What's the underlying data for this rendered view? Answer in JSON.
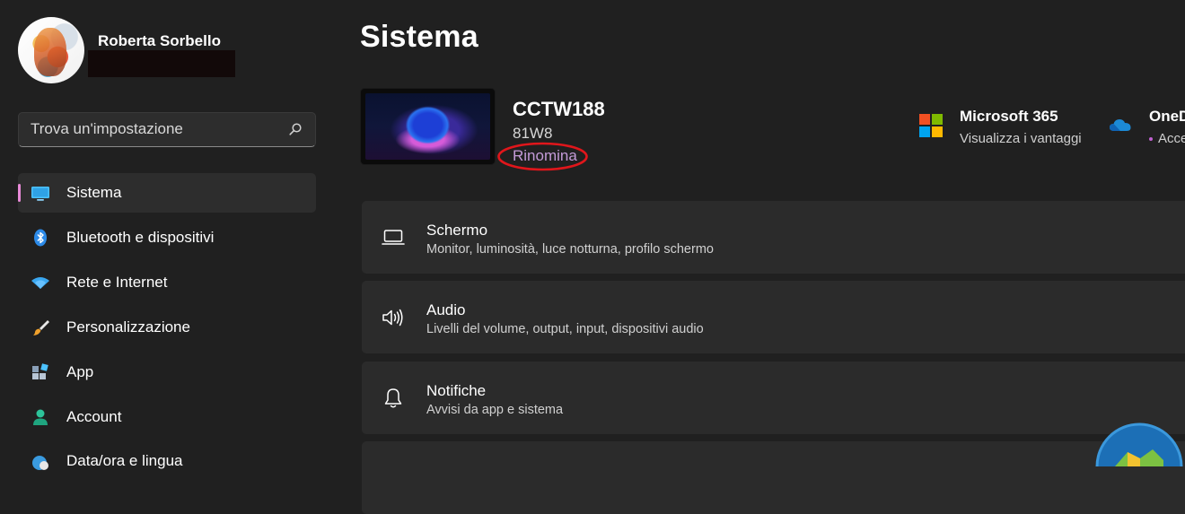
{
  "user": {
    "name": "Roberta Sorbello"
  },
  "search": {
    "placeholder": "Trova un'impostazione",
    "icon": "search-icon"
  },
  "sidebar": {
    "items": [
      {
        "label": "Sistema",
        "icon": "monitor-icon",
        "active": true
      },
      {
        "label": "Bluetooth e dispositivi",
        "icon": "bluetooth-icon"
      },
      {
        "label": "Rete e Internet",
        "icon": "wifi-icon"
      },
      {
        "label": "Personalizzazione",
        "icon": "brush-icon"
      },
      {
        "label": "App",
        "icon": "apps-icon"
      },
      {
        "label": "Account",
        "icon": "account-icon"
      },
      {
        "label": "Data/ora e lingua",
        "icon": "globe-clock-icon"
      }
    ]
  },
  "main": {
    "title": "Sistema",
    "device": {
      "name": "CCTW188",
      "model": "81W8",
      "rename_label": "Rinomina"
    },
    "promos": [
      {
        "title": "Microsoft 365",
        "subtitle": "Visualizza i vantaggi",
        "icon": "microsoft-logo-icon"
      },
      {
        "title": "OneD",
        "subtitle": "Acce",
        "icon": "onedrive-cloud-icon"
      }
    ],
    "cards": [
      {
        "title": "Schermo",
        "description": "Monitor, luminosità, luce notturna, profilo schermo",
        "icon": "laptop-icon"
      },
      {
        "title": "Audio",
        "description": "Livelli del volume, output, input, dispositivi audio",
        "icon": "speaker-icon"
      },
      {
        "title": "Notifiche",
        "description": "Avvisi da app e sistema",
        "icon": "bell-icon"
      }
    ]
  },
  "colors": {
    "background": "#202020",
    "card": "#2b2b2b",
    "accent_indicator": "#e88ad8",
    "link": "#c49bd8",
    "annotation": "#e0161b"
  }
}
